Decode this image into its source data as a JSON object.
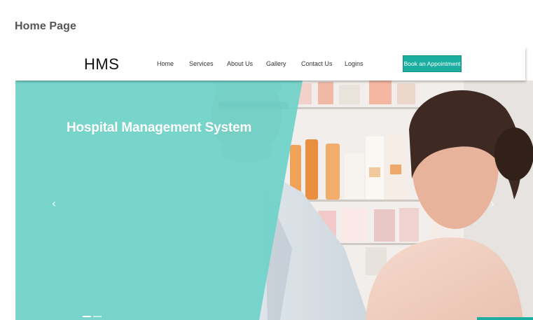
{
  "doc": {
    "heading": "Home Page"
  },
  "navbar": {
    "brand": "HMS",
    "links": [
      "Home",
      "Services",
      "About Us",
      "Gallery",
      "Contact Us",
      "Logins"
    ],
    "cta_label": "Book an Appointment"
  },
  "hero": {
    "title": "Hospital Management System",
    "prev_icon": "chevron-left-icon",
    "next_icon": "chevron-right-icon"
  },
  "colors": {
    "accent": "#1aaea0",
    "overlay": "#6fd3c9"
  }
}
